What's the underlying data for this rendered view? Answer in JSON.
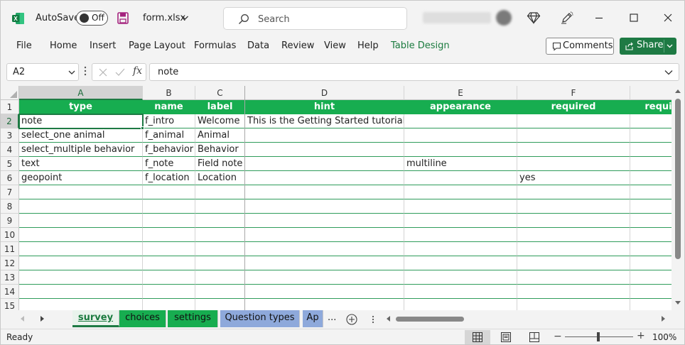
{
  "titlebar": {
    "autosave_label": "AutoSave",
    "autosave_state": "Off",
    "filename": "form.xlsx",
    "search_placeholder": "Search",
    "icons": [
      "excel-logo-icon",
      "save-icon",
      "chevron-down-icon",
      "search-icon",
      "diamond-icon",
      "pen-icon",
      "minimize-icon",
      "maximize-icon",
      "close-icon"
    ]
  },
  "ribbon": {
    "tabs": [
      "File",
      "Home",
      "Insert",
      "Page Layout",
      "Formulas",
      "Data",
      "Review",
      "View",
      "Help",
      "Table Design"
    ],
    "comments_label": "Comments",
    "share_label": "Share"
  },
  "formula_bar": {
    "name_box": "A2",
    "fx": "fx",
    "content": "note"
  },
  "grid": {
    "column_letters": [
      "A",
      "B",
      "C",
      "D",
      "E",
      "F",
      ""
    ],
    "row_numbers": [
      "1",
      "2",
      "3",
      "4",
      "5",
      "6",
      "7",
      "8",
      "9",
      "10",
      "11",
      "12",
      "13",
      "14",
      "15"
    ],
    "header_row": [
      "type",
      "name",
      "label",
      "hint",
      "appearance",
      "required",
      "requi"
    ],
    "rows": [
      [
        "note",
        "f_intro",
        "Welcome",
        "This is the Getting Started tutorial.",
        "",
        "",
        ""
      ],
      [
        "select_one animal",
        "f_animal",
        "Animal",
        "",
        "",
        "",
        ""
      ],
      [
        "select_multiple behavior",
        "f_behavior",
        "Behavior",
        "",
        "",
        "",
        ""
      ],
      [
        "text",
        "f_note",
        "Field note",
        "",
        "multiline",
        "",
        ""
      ],
      [
        "geopoint",
        "f_location",
        "Location",
        "",
        "",
        "yes",
        ""
      ]
    ],
    "active_cell": "A2",
    "colors": {
      "header_fill": "#17ad50",
      "accent": "#1e7a44"
    }
  },
  "sheet_tabs": {
    "tabs": [
      {
        "label": "survey",
        "style": "active"
      },
      {
        "label": "choices",
        "style": "green"
      },
      {
        "label": "settings",
        "style": "green"
      },
      {
        "label": "Question types",
        "style": "blue"
      },
      {
        "label": "Ap",
        "style": "blue"
      }
    ],
    "more_label": "..."
  },
  "status_bar": {
    "status": "Ready",
    "zoom": "100%",
    "zoom_minus": "−",
    "zoom_plus": "+"
  }
}
